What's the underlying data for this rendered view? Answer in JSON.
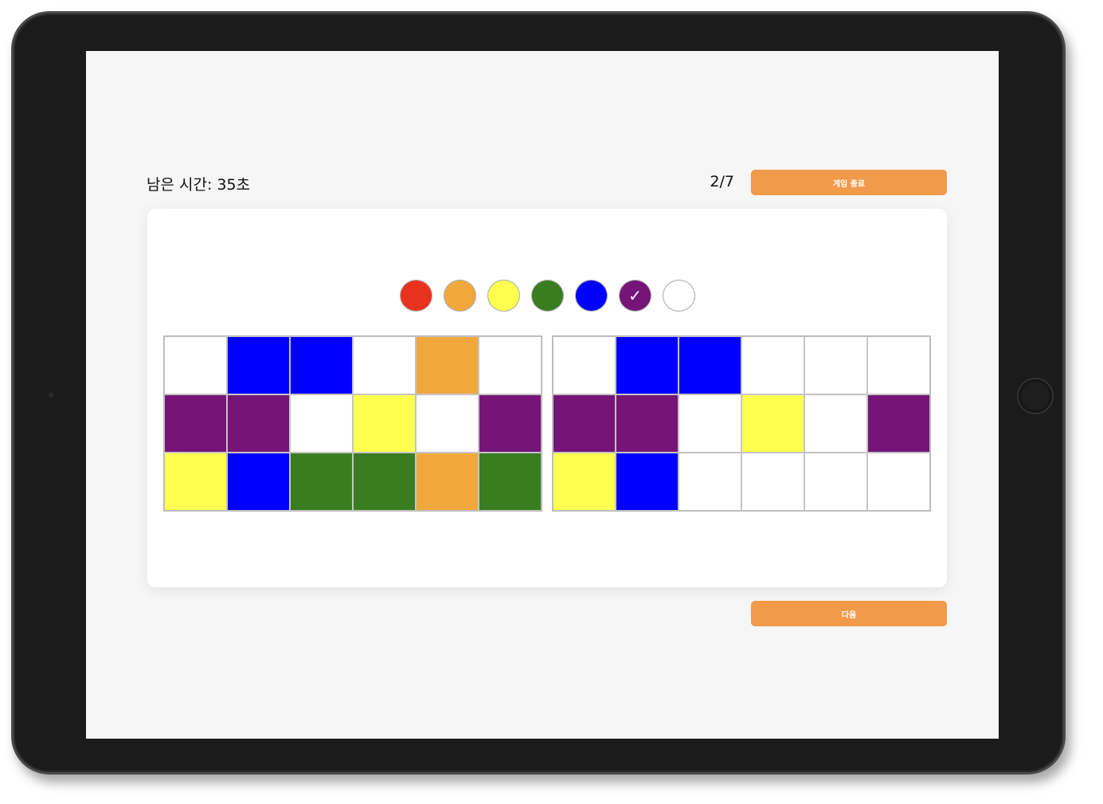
{
  "header": {
    "timer_text": "남은 시간: 35초",
    "progress_text": "2/7",
    "end_button_label": "게임 종료"
  },
  "footer": {
    "next_button_label": "다음"
  },
  "colors": {
    "R": "#e8321e",
    "O": "#f0a83c",
    "Y": "#ffff50",
    "G": "#3a7d20",
    "B": "#0000ff",
    "P": "#751578",
    "W": "#ffffff",
    "accent": "#f09a4a"
  },
  "palette": [
    {
      "name": "red",
      "color": "R",
      "selected": false
    },
    {
      "name": "orange",
      "color": "O",
      "selected": false
    },
    {
      "name": "yellow",
      "color": "Y",
      "selected": false
    },
    {
      "name": "green",
      "color": "G",
      "selected": false
    },
    {
      "name": "blue",
      "color": "B",
      "selected": false
    },
    {
      "name": "purple",
      "color": "P",
      "selected": true
    },
    {
      "name": "white",
      "color": "W",
      "selected": false
    }
  ],
  "selected_icon": "checkmark-icon",
  "target_grid": [
    [
      "W",
      "B",
      "B",
      "W",
      "O",
      "W"
    ],
    [
      "P",
      "P",
      "W",
      "Y",
      "W",
      "P"
    ],
    [
      "Y",
      "B",
      "G",
      "G",
      "O",
      "G"
    ]
  ],
  "answer_grid": [
    [
      "W",
      "B",
      "B",
      "W",
      "W",
      "W"
    ],
    [
      "P",
      "P",
      "W",
      "Y",
      "W",
      "P"
    ],
    [
      "Y",
      "B",
      "W",
      "W",
      "W",
      "W"
    ]
  ]
}
